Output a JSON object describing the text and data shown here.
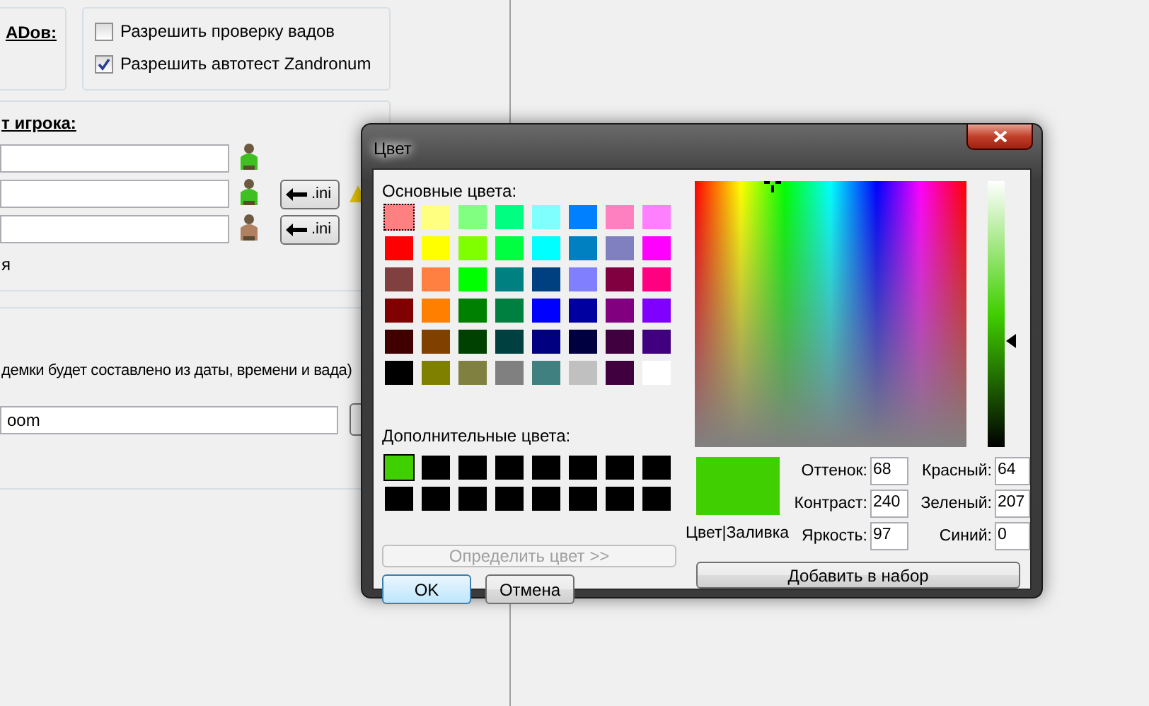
{
  "background": {
    "wad_group": {
      "title": "ADов:"
    },
    "checkboxes": [
      {
        "label": "Разрешить проверку вадов",
        "checked": false
      },
      {
        "label": "Разрешить автотест Zandronum",
        "checked": true
      }
    ],
    "player_group": {
      "title": "т игрока:",
      "rows": [
        {
          "color": "#40c020"
        },
        {
          "color": "#40c020",
          "button": ".ini"
        },
        {
          "color": "#b08060",
          "button": ".ini"
        }
      ],
      "note": "я"
    },
    "demo_group": {
      "note": "демки будет составлено из даты, времени и вада)",
      "path_value": "oom"
    }
  },
  "dialog": {
    "title": "Цвет",
    "basic_label": "Основные цвета:",
    "basic_colors": [
      {
        "color": "#ff8080",
        "selected": true
      },
      {
        "color": "#ffff80",
        "selected": false
      },
      {
        "color": "#80ff80",
        "selected": false
      },
      {
        "color": "#00ff80",
        "selected": false
      },
      {
        "color": "#80ffff",
        "selected": false
      },
      {
        "color": "#0080ff",
        "selected": false
      },
      {
        "color": "#ff80c0",
        "selected": false
      },
      {
        "color": "#ff80ff",
        "selected": false
      },
      {
        "color": "#ff0000",
        "selected": false
      },
      {
        "color": "#ffff00",
        "selected": false
      },
      {
        "color": "#80ff00",
        "selected": false
      },
      {
        "color": "#00ff40",
        "selected": false
      },
      {
        "color": "#00ffff",
        "selected": false
      },
      {
        "color": "#0080c0",
        "selected": false
      },
      {
        "color": "#8080c0",
        "selected": false
      },
      {
        "color": "#ff00ff",
        "selected": false
      },
      {
        "color": "#804040",
        "selected": false
      },
      {
        "color": "#ff8040",
        "selected": false
      },
      {
        "color": "#00ff00",
        "selected": false
      },
      {
        "color": "#008080",
        "selected": false
      },
      {
        "color": "#004080",
        "selected": false
      },
      {
        "color": "#8080ff",
        "selected": false
      },
      {
        "color": "#800040",
        "selected": false
      },
      {
        "color": "#ff0080",
        "selected": false
      },
      {
        "color": "#800000",
        "selected": false
      },
      {
        "color": "#ff8000",
        "selected": false
      },
      {
        "color": "#008000",
        "selected": false
      },
      {
        "color": "#008040",
        "selected": false
      },
      {
        "color": "#0000ff",
        "selected": false
      },
      {
        "color": "#0000a0",
        "selected": false
      },
      {
        "color": "#800080",
        "selected": false
      },
      {
        "color": "#8000ff",
        "selected": false
      },
      {
        "color": "#400000",
        "selected": false
      },
      {
        "color": "#804000",
        "selected": false
      },
      {
        "color": "#004000",
        "selected": false
      },
      {
        "color": "#004040",
        "selected": false
      },
      {
        "color": "#000080",
        "selected": false
      },
      {
        "color": "#000040",
        "selected": false
      },
      {
        "color": "#400040",
        "selected": false
      },
      {
        "color": "#400080",
        "selected": false
      },
      {
        "color": "#000000",
        "selected": false
      },
      {
        "color": "#808000",
        "selected": false
      },
      {
        "color": "#808040",
        "selected": false
      },
      {
        "color": "#808080",
        "selected": false
      },
      {
        "color": "#408080",
        "selected": false
      },
      {
        "color": "#c0c0c0",
        "selected": false
      },
      {
        "color": "#400040",
        "selected": false
      },
      {
        "color": "#ffffff",
        "selected": false
      }
    ],
    "custom_label": "Дополнительные цвета:",
    "custom_colors": [
      {
        "color": "#40cf00",
        "selected": true
      },
      {
        "color": "#000000",
        "selected": false
      },
      {
        "color": "#000000",
        "selected": false
      },
      {
        "color": "#000000",
        "selected": false
      },
      {
        "color": "#000000",
        "selected": false
      },
      {
        "color": "#000000",
        "selected": false
      },
      {
        "color": "#000000",
        "selected": false
      },
      {
        "color": "#000000",
        "selected": false
      },
      {
        "color": "#000000",
        "selected": false
      },
      {
        "color": "#000000",
        "selected": false
      },
      {
        "color": "#000000",
        "selected": false
      },
      {
        "color": "#000000",
        "selected": false
      },
      {
        "color": "#000000",
        "selected": false
      },
      {
        "color": "#000000",
        "selected": false
      },
      {
        "color": "#000000",
        "selected": false
      },
      {
        "color": "#000000",
        "selected": false
      }
    ],
    "define_button": {
      "label": "Определить цвет >>",
      "disabled": true
    },
    "ok_button": "OK",
    "cancel_button": "Отмена",
    "spectrum": {
      "level": 0.285
    },
    "luminance": {
      "level": 0.4
    },
    "preview": {
      "color": "#40cf00",
      "label": "Цвет|Заливка"
    },
    "fields": [
      {
        "label": "Оттенок:",
        "value": "68"
      },
      {
        "label": "Красный:",
        "value": "64"
      },
      {
        "label": "Контраст:",
        "value": "240"
      },
      {
        "label": "Зеленый:",
        "value": "207"
      },
      {
        "label": "Яркость:",
        "value": "97"
      },
      {
        "label": "Синий:",
        "value": "0"
      }
    ],
    "add_button": "Добавить в набор"
  }
}
